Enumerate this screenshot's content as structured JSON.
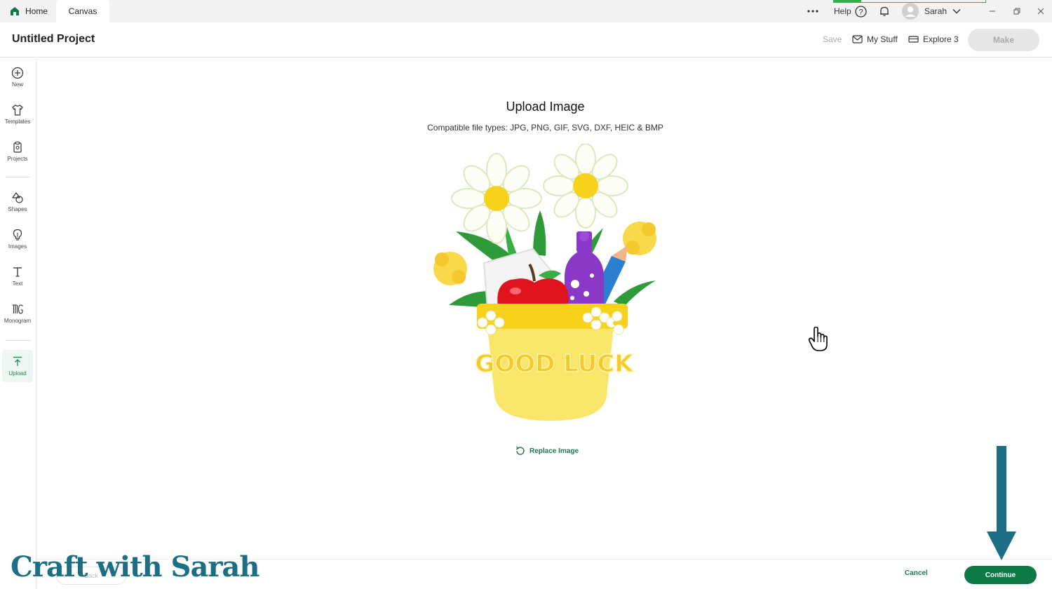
{
  "tabs": [
    {
      "label": "Home",
      "icon": "home-icon"
    },
    {
      "label": "Canvas"
    }
  ],
  "window": {
    "more_icon": "more-horizontal-icon",
    "help_label": "Help",
    "user_name": "Sarah",
    "progress_fraction": 0.18
  },
  "header": {
    "project_title": "Untitled Project",
    "save_label": "Save",
    "my_stuff_label": "My Stuff",
    "machine_label": "Explore 3",
    "make_label": "Make"
  },
  "sidebar": {
    "items": [
      {
        "label": "New",
        "icon": "plus-circle-icon"
      },
      {
        "label": "Templates",
        "icon": "shirt-icon"
      },
      {
        "label": "Projects",
        "icon": "clipboard-icon"
      },
      {
        "label": "Shapes",
        "icon": "shapes-icon"
      },
      {
        "label": "Images",
        "icon": "lightbulb-icon"
      },
      {
        "label": "Text",
        "icon": "text-t-icon"
      },
      {
        "label": "Monogram",
        "icon": "monogram-icon"
      },
      {
        "label": "Upload",
        "icon": "upload-icon"
      }
    ]
  },
  "main": {
    "title": "Upload Image",
    "subtitle": "Compatible file types:  JPG, PNG, GIF, SVG, DXF, HEIC & BMP",
    "artwork_text": "GOOD LUCK",
    "replace_label": "Replace Image"
  },
  "footer": {
    "back_label": "Back",
    "cancel_label": "Cancel",
    "continue_label": "Continue"
  },
  "watermark": "Craft with Sarah",
  "colors": {
    "accent": "#0d7a46",
    "watermark": "#1b6e84",
    "arrow": "#1b6e84"
  }
}
